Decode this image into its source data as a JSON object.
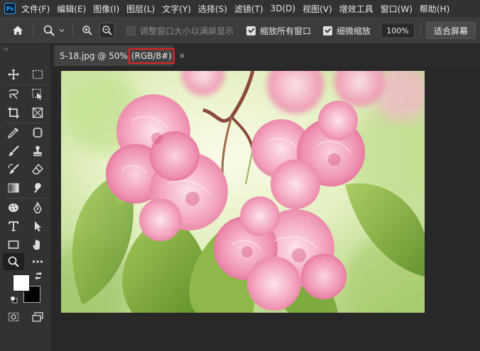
{
  "app": {
    "logo": "Ps",
    "menu": [
      "文件(F)",
      "编辑(E)",
      "图像(I)",
      "图层(L)",
      "文字(Y)",
      "选择(S)",
      "滤镜(T)",
      "3D(D)",
      "视图(V)",
      "增效工具",
      "窗口(W)",
      "帮助(H)"
    ]
  },
  "options": {
    "home_icon": "home-icon",
    "zoom_tool_icon": "zoom-tool-icon",
    "zoom_in_icon": "zoom-in-icon",
    "zoom_out_icon": "zoom-out-icon",
    "resize_windows": {
      "label": "调整窗口大小以满屏显示",
      "checked": false
    },
    "zoom_all": {
      "label": "缩放所有窗口",
      "checked": true
    },
    "scrubby": {
      "label": "细微缩放",
      "checked": true
    },
    "zoom_value": "100%",
    "fit_screen": "适合屏幕"
  },
  "document": {
    "tab_name": "5-18.jpg @ 50%",
    "tab_mode": "(RGB/8#)",
    "close_glyph": "×",
    "highlight_color": "#e02424"
  },
  "tools": {
    "collapse_glyph": "‹‹",
    "active": "zoom-tool",
    "foreground_color": "#ffffff",
    "background_color": "#000000"
  }
}
